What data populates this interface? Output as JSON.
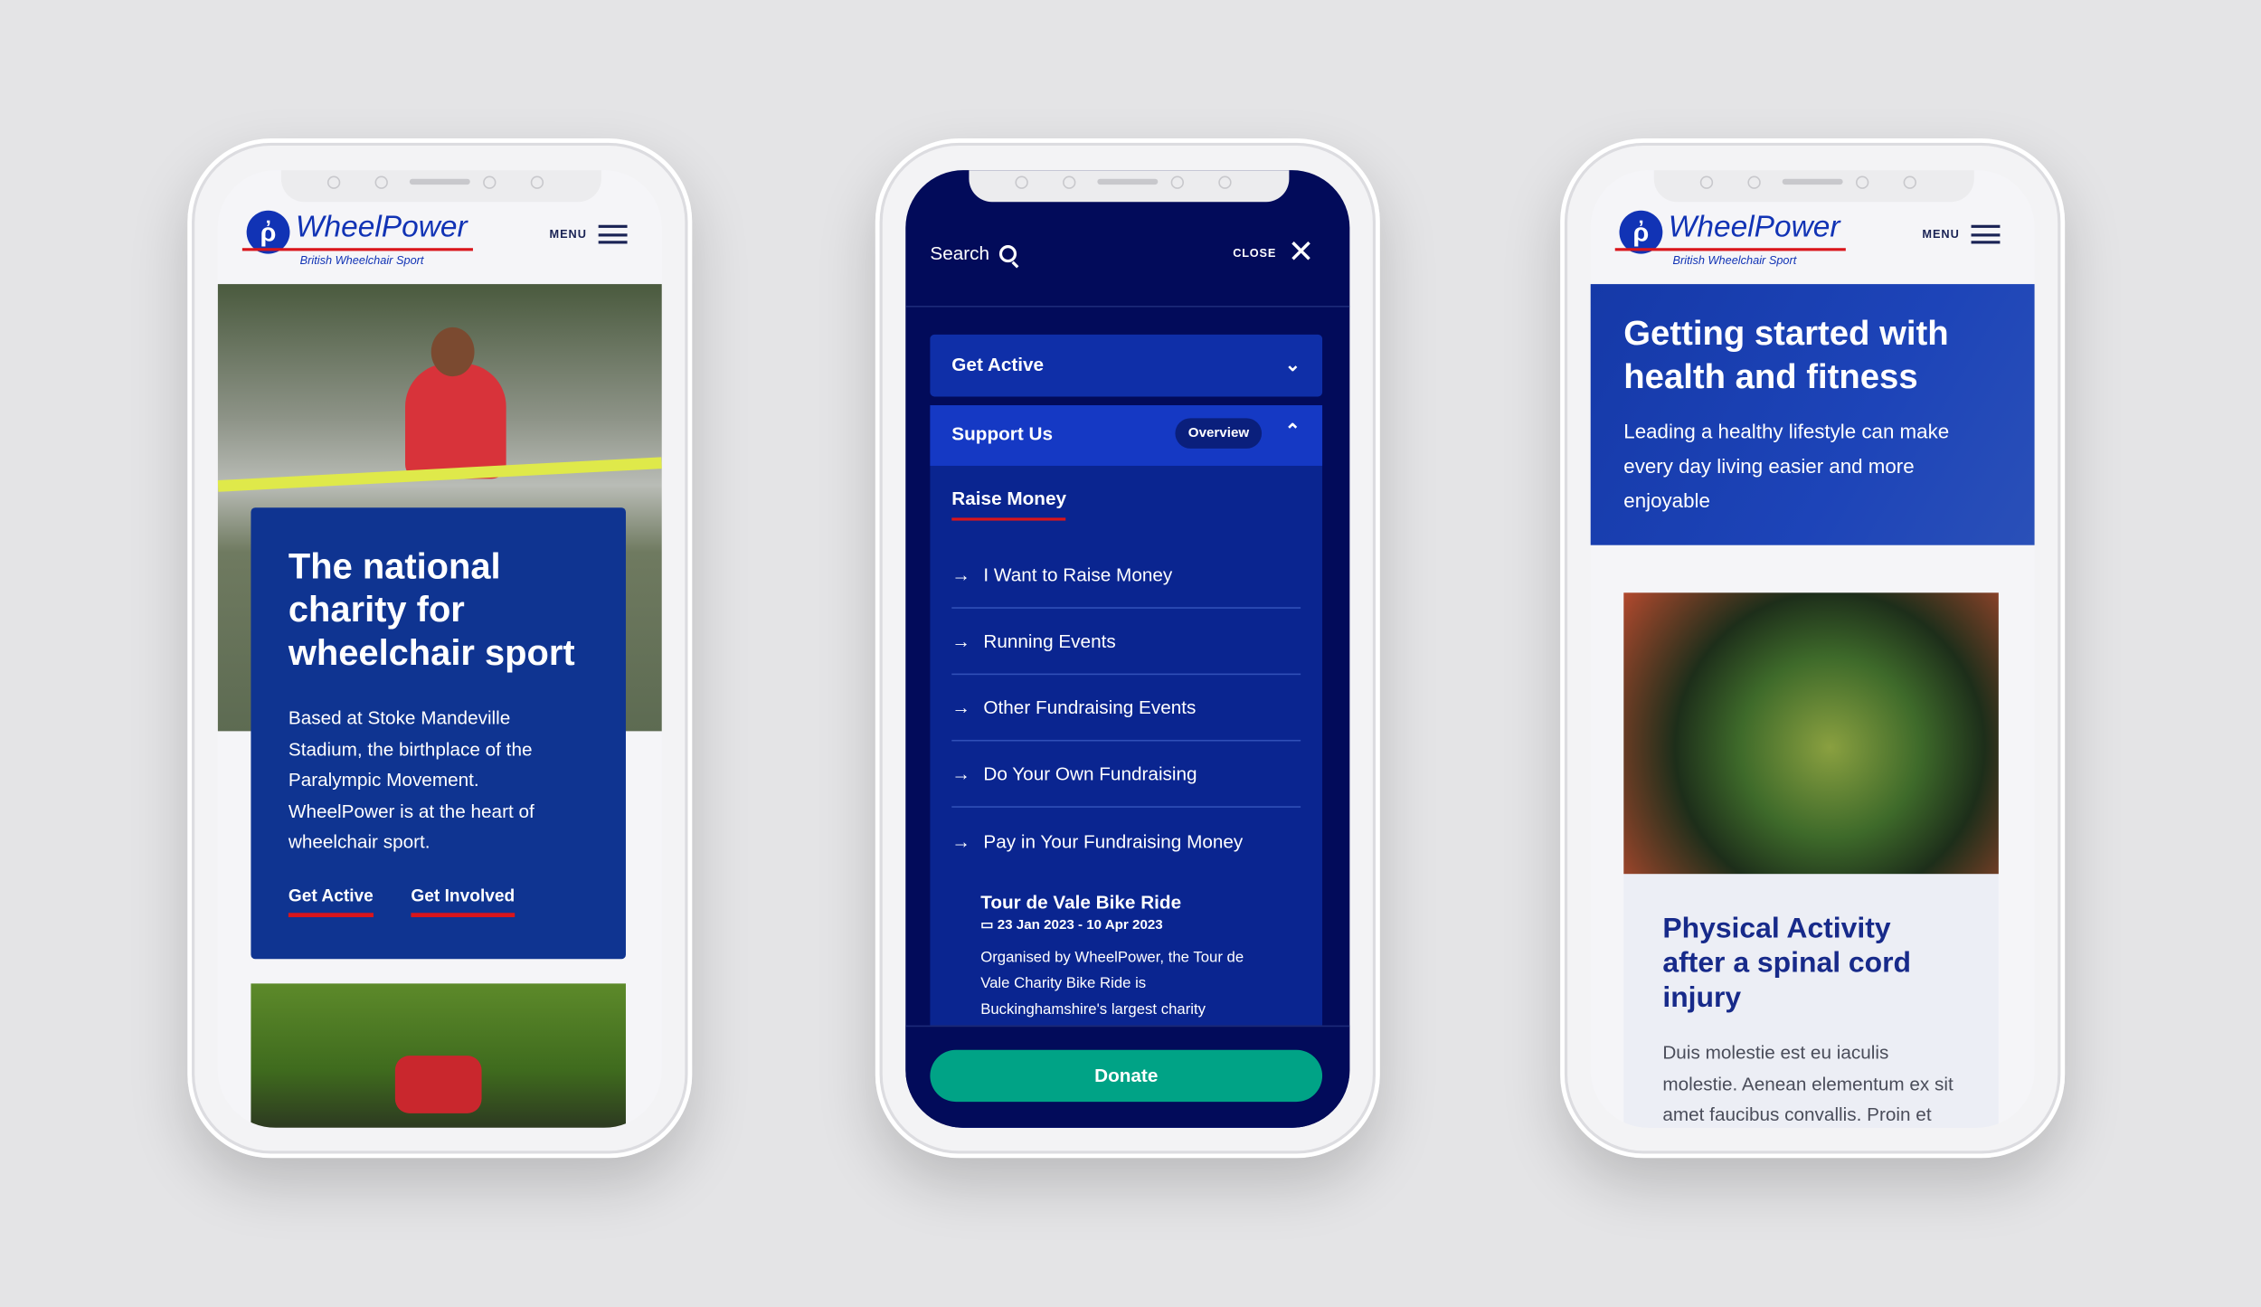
{
  "brand": {
    "name": "WheelPower",
    "tagline": "British Wheelchair Sport",
    "menu_label": "MENU"
  },
  "colors": {
    "brand_blue": "#1133b5",
    "navy": "#020b5a",
    "accent_red": "#d9151b",
    "donate_green": "#00a386"
  },
  "home": {
    "title": "The national charity for wheelchair sport",
    "body": "Based at Stoke Mandeville Stadium, the birthplace of the Paralympic Movement. WheelPower is at the heart of wheelchair sport.",
    "links": [
      "Get Active",
      "Get Involved"
    ]
  },
  "nav": {
    "search_label": "Search",
    "close_label": "CLOSE",
    "sections": [
      {
        "label": "Get Active",
        "expanded": false
      },
      {
        "label": "Support Us",
        "expanded": true,
        "overview_label": "Overview"
      }
    ],
    "subheading": "Raise Money",
    "items": [
      "I Want to Raise Money",
      "Running Events",
      "Other Fundraising Events",
      "Do Your Own Fundraising",
      "Pay in Your Fundraising Money"
    ],
    "event": {
      "title": "Tour de Vale Bike Ride",
      "dates": "23 Jan 2023 - 10 Apr 2023",
      "description": "Organised by WheelPower, the Tour de Vale Charity Bike Ride is Buckinghamshire's largest charity"
    },
    "donate_label": "Donate"
  },
  "article": {
    "banner_title": "Getting started with health and fitness",
    "banner_subtitle": "Leading a healthy lifestyle can make every day living easier and more enjoyable",
    "card_title": "Physical Activity after a spinal cord injury",
    "card_body": "Duis molestie est eu iaculis molestie. Aenean elementum ex sit amet faucibus convallis. Proin et"
  }
}
